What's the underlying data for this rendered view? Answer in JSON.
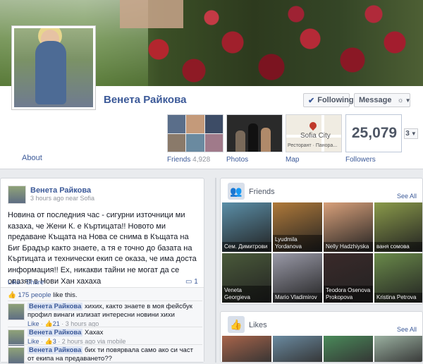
{
  "profile": {
    "name": "Венета Райкова",
    "following_label": "Following",
    "message_label": "Message",
    "gear_label": "☼",
    "about_label": "About"
  },
  "tabs": {
    "friends_label": "Friends",
    "friends_count": "4,928",
    "photos_label": "Photos",
    "map_label": "Map",
    "map_city": "Sofia City",
    "map_restaurant": "Ресторант · Панора...",
    "followers_label": "Followers",
    "followers_count": "25,079",
    "dropdown_label": "3"
  },
  "post": {
    "author": "Венета Райкова",
    "meta": "3 hours ago near Sofia",
    "text": "Новина от последния час - сигурни източници ми казаха, че Жени К. е Къртицата!! Новото ми предаване Къщата на Нова се снима в Къщата на Биг Брадър както знаете, а тя е точно до базата на Къртицата и технически екип се оказа, че има доста информация!! Ех, никакви тайни не могат да се опазят в Нови Хан хахаха",
    "like_label": "Like",
    "share_label": "Share",
    "comment_count": "1",
    "likes_link": "175 people",
    "likes_text": "like this.",
    "comments": [
      {
        "author": "Венета Райкова",
        "text": "хихих, както знаете в моя фейсбук профил винаги излизат интересни новини хихи",
        "like": "Like",
        "likes": "21",
        "time": "3 hours ago",
        "via": ""
      },
      {
        "author": "Венета Райкова",
        "text": "Хахах",
        "like": "Like",
        "likes": "3",
        "time": "2 hours ago",
        "via": "via mobile"
      },
      {
        "author": "Венета Райкова",
        "text": "бих ти повярвала само ако си част от екипа на предаването??",
        "like": "",
        "likes": "",
        "time": "",
        "via": ""
      }
    ]
  },
  "friends_box": {
    "title": "Friends",
    "see_all": "See All",
    "items": [
      {
        "name": "Сем. Димитрови",
        "color": "#5b8fa8"
      },
      {
        "name": "Lyudmila Yordanova",
        "color": "#b07a3a"
      },
      {
        "name": "Nelly Hadzhiyska",
        "color": "#d8a07a"
      },
      {
        "name": "ваня сомова",
        "color": "#8a9a4a"
      },
      {
        "name": "Veneta Georgieva",
        "color": "#4a5a3a"
      },
      {
        "name": "Mario Vladimirov",
        "color": "#9a9aa8"
      },
      {
        "name": "Teodora Osenova Prokopova",
        "color": "#3a2a2a"
      },
      {
        "name": "Kristina Petrova",
        "color": "#6a8a4a"
      }
    ]
  },
  "likes_box": {
    "title": "Likes",
    "see_all": "See All",
    "colors": [
      "#a8644a",
      "#6a8aa0",
      "#4a8a5a",
      "#9ab0a0"
    ]
  }
}
